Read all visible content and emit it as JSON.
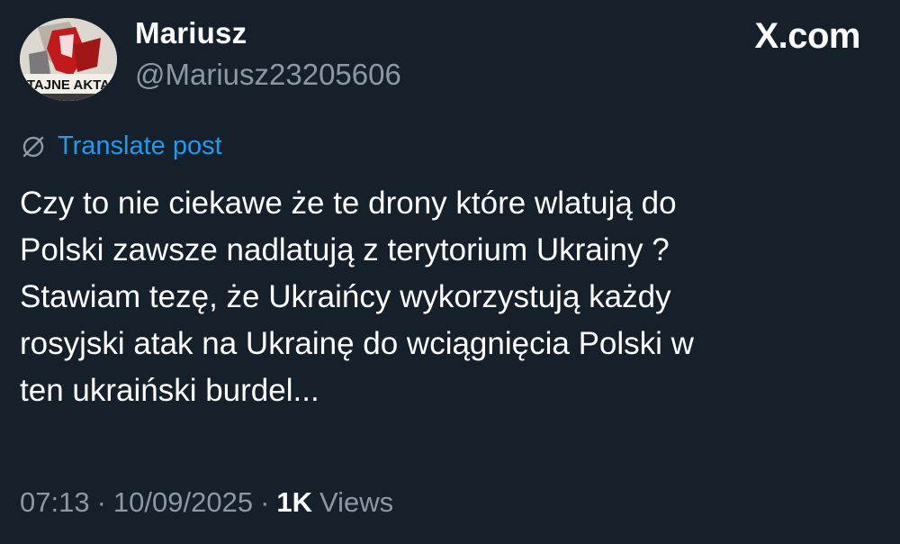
{
  "author": {
    "display_name": "Mariusz",
    "handle": "@Mariusz23205606",
    "avatar_caption": "TAJNE AKTA"
  },
  "brand": {
    "label": "X.com",
    "icon": "x-logo-icon"
  },
  "translate": {
    "label": "Translate post",
    "icon": "translate-globe-icon"
  },
  "post": {
    "lines": [
      "Czy to nie ciekawe że te drony które wlatują do",
      "Polski zawsze nadlatują z terytorium Ukrainy ?",
      "Stawiam tezę, że Ukraińcy wykorzystują każdy",
      "rosyjski atak na Ukrainę do wciągnięcia Polski w",
      "ten ukraiński burdel..."
    ]
  },
  "meta": {
    "time": "07:13",
    "sep1": "·",
    "date": "10/09/2025",
    "sep2": "·",
    "views_count": "1K",
    "views_label": "Views"
  },
  "colors": {
    "background": "#15202b",
    "text_primary": "#ffffff",
    "text_secondary": "#8b98a5",
    "link": "#1d9bf0"
  }
}
